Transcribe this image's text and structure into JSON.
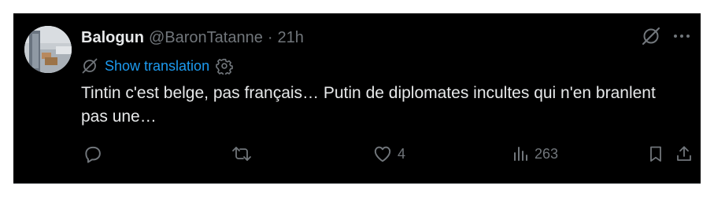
{
  "tweet": {
    "display_name": "Balogun",
    "handle": "@BaronTatanne",
    "separator": "·",
    "time": "21h",
    "show_translation": "Show translation",
    "text": "Tintin c'est belge, pas français… Putin de diplomates incultes qui n'en branlent pas une…",
    "likes": "4",
    "views": "263"
  },
  "icons": {
    "grok": "slashed-circle-icon",
    "more": "more-dots-icon",
    "translate": "slashed-circle-icon",
    "translation_settings": "gear-icon",
    "reply": "reply-bubble-icon",
    "retweet": "retweet-icon",
    "like": "heart-icon",
    "views": "analytics-bars-icon",
    "bookmark": "bookmark-icon",
    "share": "share-icon"
  },
  "colors": {
    "background": "#000000",
    "text": "#e7e9ea",
    "muted": "#71767b",
    "link": "#1d9bf0"
  }
}
